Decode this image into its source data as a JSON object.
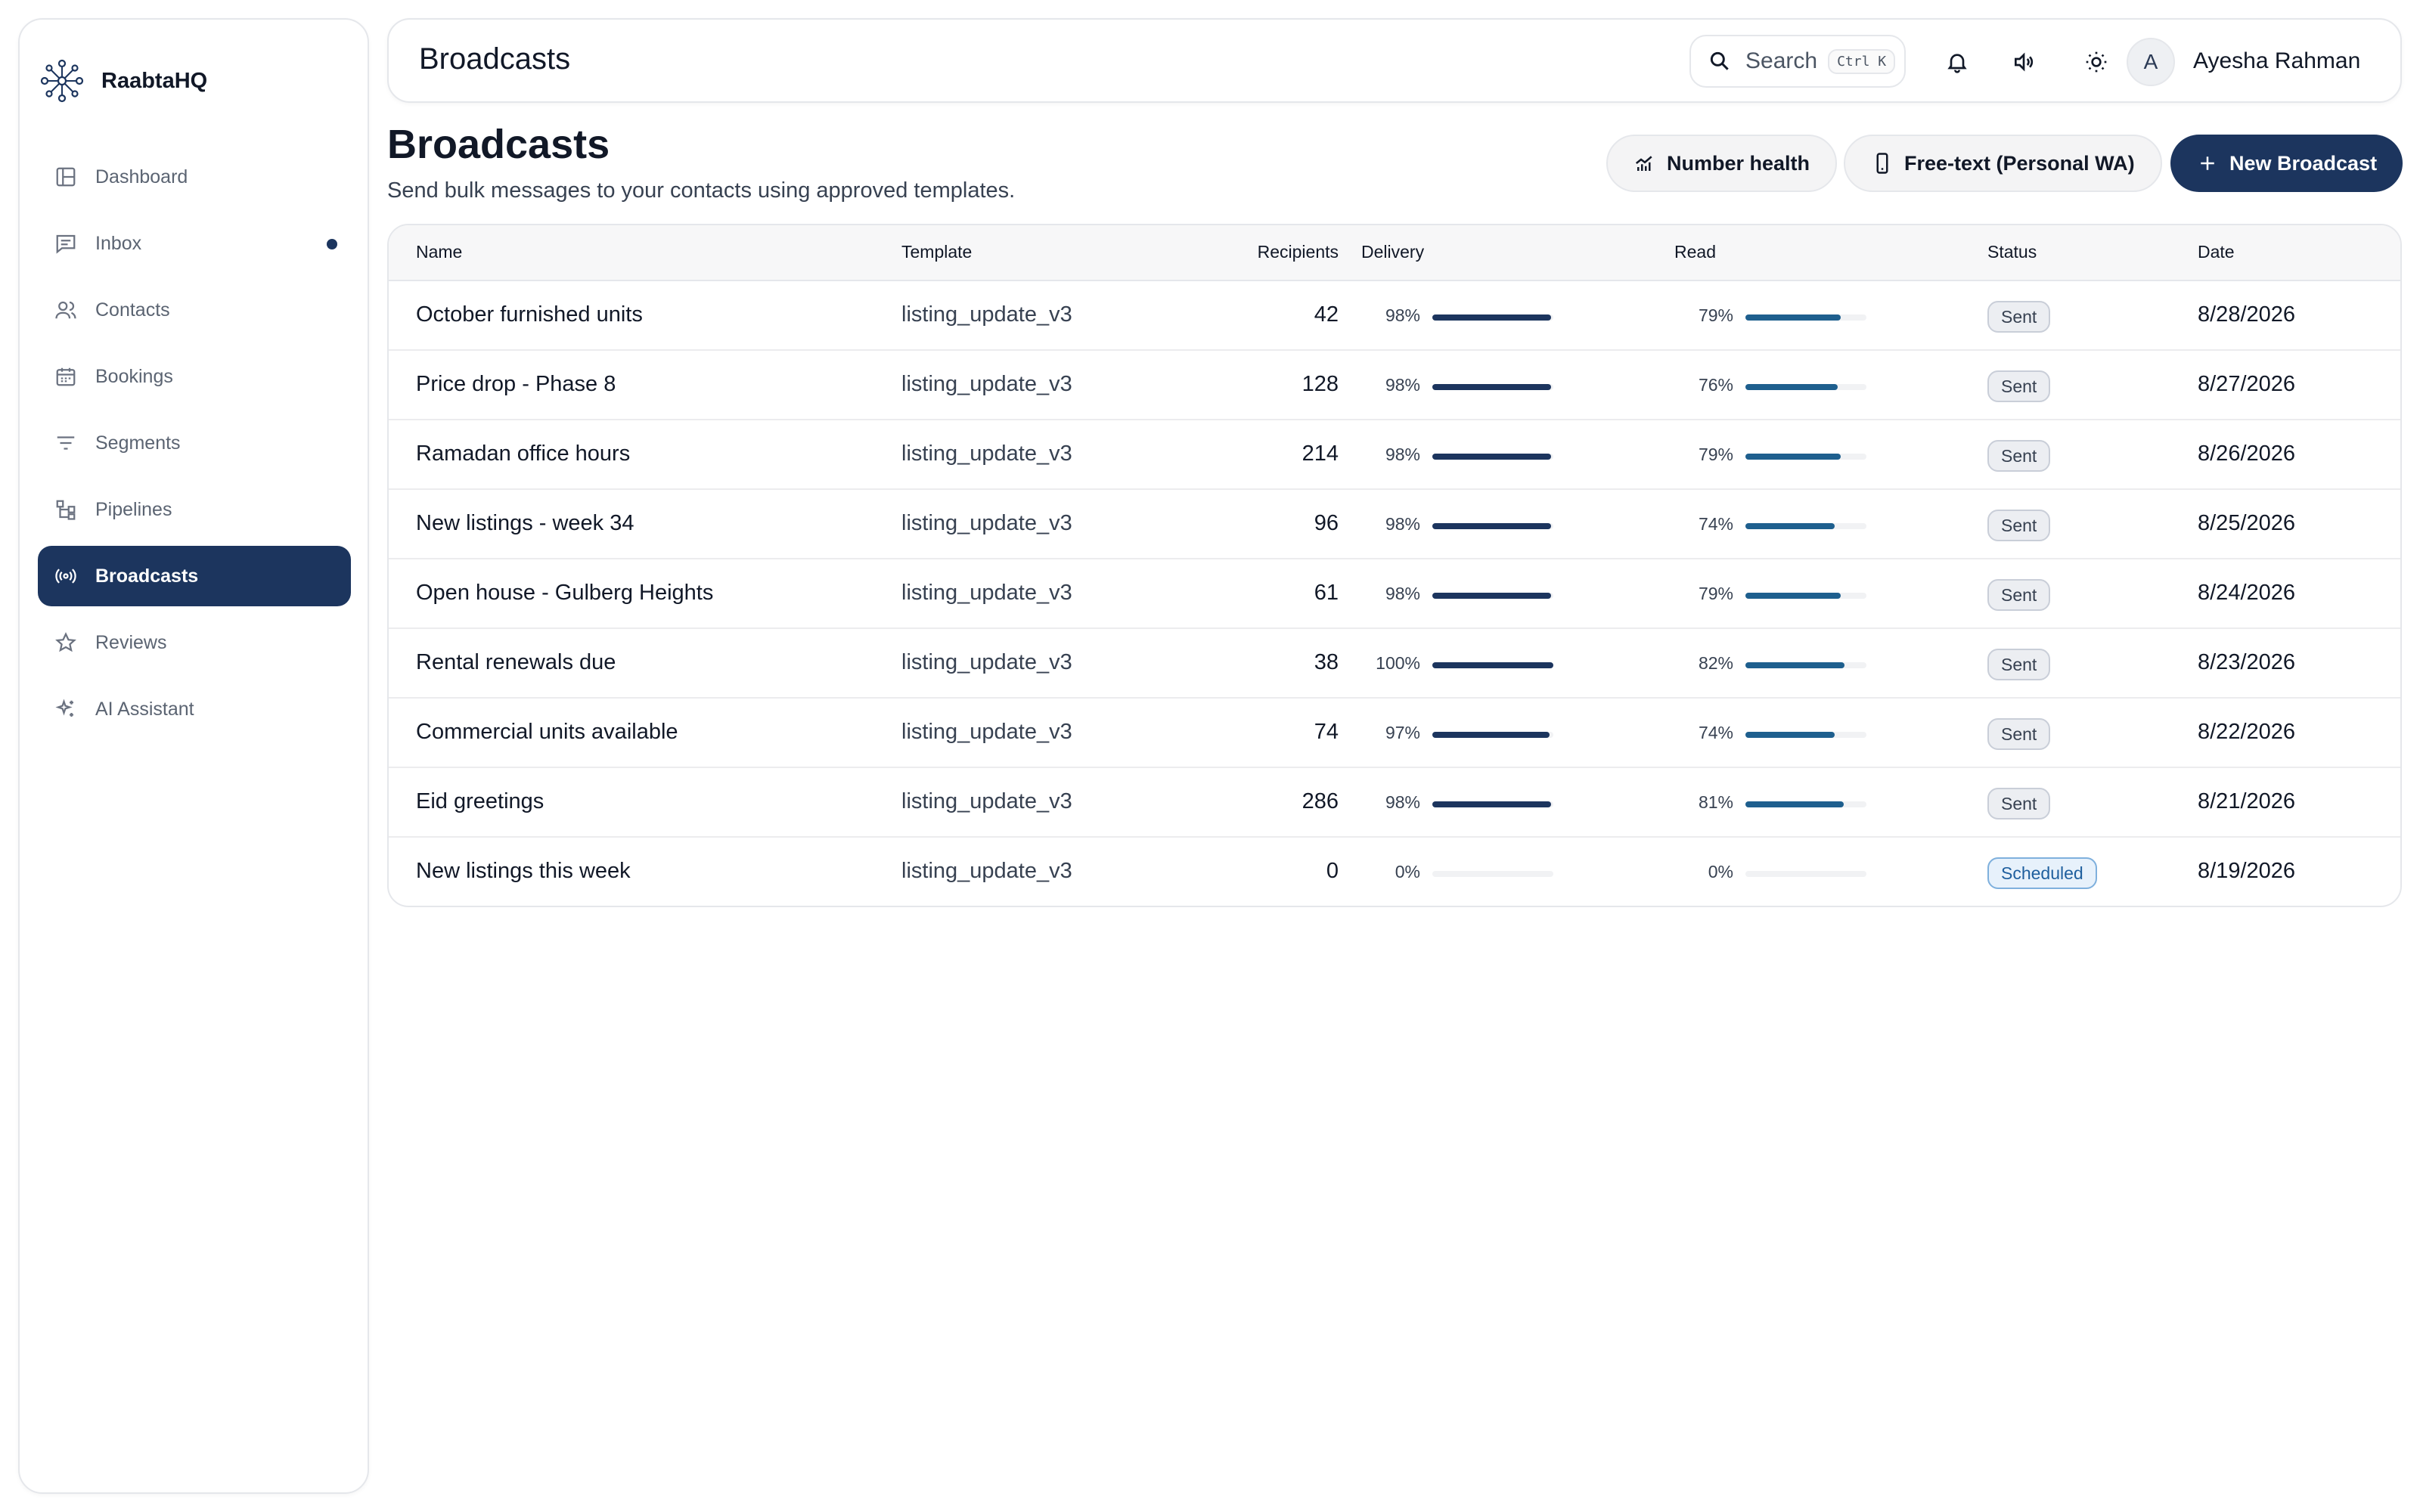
{
  "brand": {
    "name": "RaabtaHQ"
  },
  "sidebar": {
    "items": [
      {
        "label": "Dashboard",
        "icon": "layout-icon",
        "active": false
      },
      {
        "label": "Inbox",
        "icon": "message-icon",
        "active": false,
        "dot": true
      },
      {
        "label": "Contacts",
        "icon": "users-icon",
        "active": false
      },
      {
        "label": "Bookings",
        "icon": "calendar-icon",
        "active": false
      },
      {
        "label": "Segments",
        "icon": "filter-icon",
        "active": false
      },
      {
        "label": "Pipelines",
        "icon": "workflow-icon",
        "active": false
      },
      {
        "label": "Broadcasts",
        "icon": "broadcast-icon",
        "active": true
      },
      {
        "label": "Reviews",
        "icon": "star-icon",
        "active": false
      },
      {
        "label": "AI Assistant",
        "icon": "sparkles-icon",
        "active": false
      }
    ]
  },
  "header": {
    "title": "Broadcasts",
    "search_label": "Search",
    "search_shortcut": "Ctrl K",
    "user_initial": "A",
    "user_name": "Ayesha Rahman"
  },
  "page": {
    "title": "Broadcasts",
    "subtitle": "Send bulk messages to your contacts using approved templates.",
    "btn_number_health": "Number health",
    "btn_free_text": "Free-text (Personal WA)",
    "btn_new_broadcast": "New Broadcast"
  },
  "table": {
    "columns": {
      "name": "Name",
      "template": "Template",
      "recipients": "Recipients",
      "delivery": "Delivery",
      "read": "Read",
      "status": "Status",
      "date": "Date"
    },
    "rows": [
      {
        "name": "October furnished units",
        "template": "listing_update_v3",
        "recipients": "42",
        "delivery": "98%",
        "delivery_value": 98,
        "read": "79%",
        "read_value": 79,
        "status": "Sent",
        "date": "8/28/2026"
      },
      {
        "name": "Price drop - Phase 8",
        "template": "listing_update_v3",
        "recipients": "128",
        "delivery": "98%",
        "delivery_value": 98,
        "read": "76%",
        "read_value": 76,
        "status": "Sent",
        "date": "8/27/2026"
      },
      {
        "name": "Ramadan office hours",
        "template": "listing_update_v3",
        "recipients": "214",
        "delivery": "98%",
        "delivery_value": 98,
        "read": "79%",
        "read_value": 79,
        "status": "Sent",
        "date": "8/26/2026"
      },
      {
        "name": "New listings - week 34",
        "template": "listing_update_v3",
        "recipients": "96",
        "delivery": "98%",
        "delivery_value": 98,
        "read": "74%",
        "read_value": 74,
        "status": "Sent",
        "date": "8/25/2026"
      },
      {
        "name": "Open house - Gulberg Heights",
        "template": "listing_update_v3",
        "recipients": "61",
        "delivery": "98%",
        "delivery_value": 98,
        "read": "79%",
        "read_value": 79,
        "status": "Sent",
        "date": "8/24/2026"
      },
      {
        "name": "Rental renewals due",
        "template": "listing_update_v3",
        "recipients": "38",
        "delivery": "100%",
        "delivery_value": 100,
        "read": "82%",
        "read_value": 82,
        "status": "Sent",
        "date": "8/23/2026"
      },
      {
        "name": "Commercial units available",
        "template": "listing_update_v3",
        "recipients": "74",
        "delivery": "97%",
        "delivery_value": 97,
        "read": "74%",
        "read_value": 74,
        "status": "Sent",
        "date": "8/22/2026"
      },
      {
        "name": "Eid greetings",
        "template": "listing_update_v3",
        "recipients": "286",
        "delivery": "98%",
        "delivery_value": 98,
        "read": "81%",
        "read_value": 81,
        "status": "Sent",
        "date": "8/21/2026"
      },
      {
        "name": "New listings this week",
        "template": "listing_update_v3",
        "recipients": "0",
        "delivery": "0%",
        "delivery_value": 0,
        "read": "0%",
        "read_value": 0,
        "status": "Scheduled",
        "date": "8/19/2026"
      }
    ]
  },
  "colors": {
    "primary": "#1c355e",
    "delivery_bar": "#1c355e",
    "read_bar": "#1e5f8e",
    "bar_track": "#f1f2f4"
  }
}
